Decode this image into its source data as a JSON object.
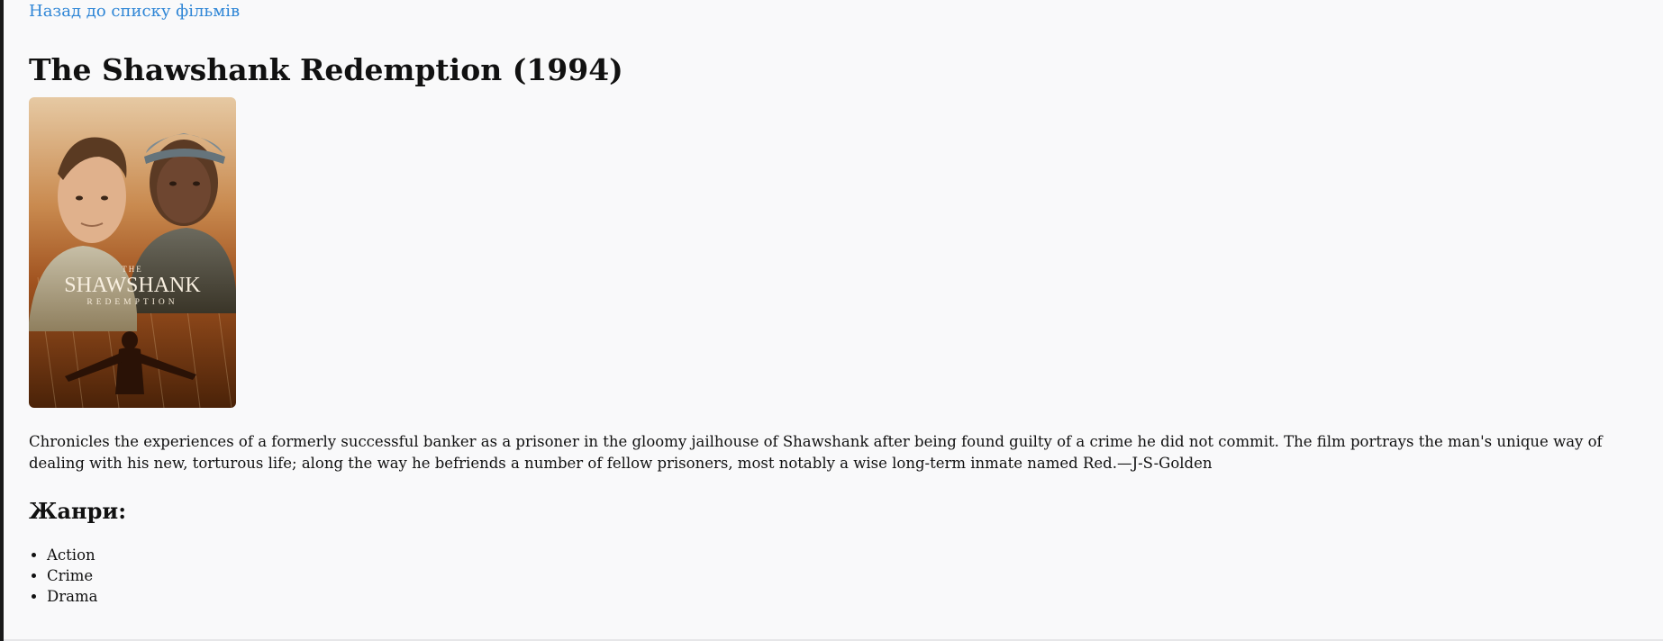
{
  "nav": {
    "back_link": "Назад до списку фільмів"
  },
  "movie": {
    "title": "The Shawshank Redemption (1994)",
    "poster": {
      "title_small": "THE",
      "title_big": "SHAWSHANK",
      "title_sub": "REDEMPTION"
    },
    "description": "Chronicles the experiences of a formerly successful banker as a prisoner in the gloomy jailhouse of Shawshank after being found guilty of a crime he did not commit. The film portrays the man's unique way of dealing with his new, torturous life; along the way he befriends a number of fellow prisoners, most notably a wise long-term inmate named Red.—J-S-Golden",
    "genres_heading": "Жанри:",
    "genres": [
      "Action",
      "Crime",
      "Drama"
    ]
  },
  "colors": {
    "link": "#2f86d6",
    "background": "#f9f9fa"
  }
}
